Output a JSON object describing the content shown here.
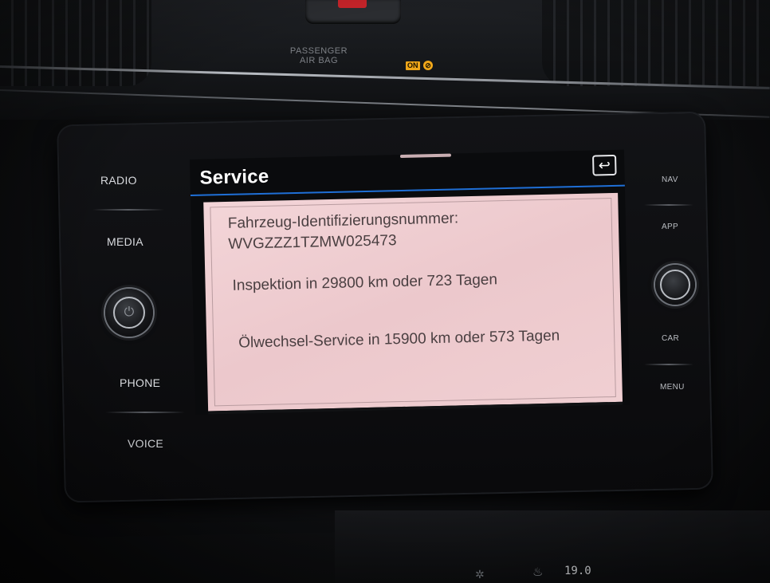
{
  "dashboard": {
    "airbag_label_line1": "PASSENGER",
    "airbag_label_line2": "AIR BAG",
    "airbag_on": "ON",
    "airbag_off_icon": "airbag-off-icon",
    "temperature": "19.0",
    "accent_amber": "#f0a71a",
    "hazard_red": "#c8242a"
  },
  "left_buttons": [
    {
      "label": "RADIO"
    },
    {
      "label": "MEDIA"
    },
    {
      "label": "PHONE"
    },
    {
      "label": "VOICE"
    }
  ],
  "right_buttons": [
    {
      "label": "NAV"
    },
    {
      "label": "APP"
    },
    {
      "label": "CAR"
    },
    {
      "label": "MENU"
    }
  ],
  "screen": {
    "title": "Service",
    "back_icon": "back-arrow-icon",
    "title_rule_color": "#1f6fd6",
    "panel_color": "#f0cfd2",
    "vin_label": "Fahrzeug-Identifizierungsnummer:",
    "vin_value": "WVGZZZ1TZMW025473",
    "inspection": "Inspektion in 29800 km oder 723 Tagen",
    "oil_service": "Ölwechsel-Service in 15900 km oder 573 Tagen"
  }
}
